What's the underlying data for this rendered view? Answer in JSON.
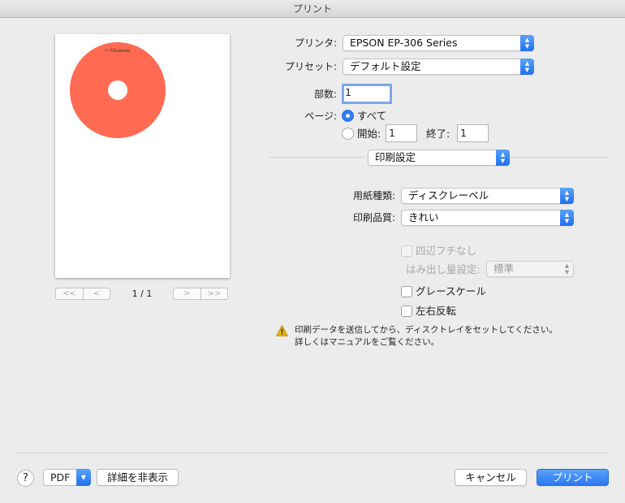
{
  "window": {
    "title": "プリント"
  },
  "preview": {
    "disc_label": "ⓔ-TOLabeler",
    "page_indicator": "1 / 1",
    "nav": {
      "first": "<<",
      "prev": "<",
      "next": ">",
      "last": ">>"
    },
    "disc_color": "#ff6b52"
  },
  "form": {
    "printer": {
      "label": "プリンタ:",
      "value": "EPSON EP-306 Series"
    },
    "preset": {
      "label": "プリセット:",
      "value": "デフォルト設定"
    },
    "copies": {
      "label": "部数:",
      "value": "1"
    },
    "pages": {
      "label": "ページ:",
      "all_label": "すべて",
      "from_label": "開始:",
      "from_value": "1",
      "to_label": "終了:",
      "to_value": "1"
    },
    "section": {
      "value": "印刷設定"
    },
    "media_type": {
      "label": "用紙種類:",
      "value": "ディスクレーベル"
    },
    "print_quality": {
      "label": "印刷品質:",
      "value": "きれい"
    },
    "borderless": {
      "label": "四辺フチなし",
      "checked": false,
      "enabled": false
    },
    "expansion": {
      "label": "はみ出し量設定:",
      "value": "標準",
      "enabled": false
    },
    "grayscale": {
      "label": "グレースケール",
      "checked": false
    },
    "mirror": {
      "label": "左右反転",
      "checked": false
    }
  },
  "warning": {
    "line1": "印刷データを送信してから、ディスクトレイをセットしてください。",
    "line2": "詳しくはマニュアルをご覧ください。"
  },
  "footer": {
    "help": "?",
    "pdf": "PDF",
    "hide_details": "詳細を非表示",
    "cancel": "キャンセル",
    "print": "プリント"
  },
  "colors": {
    "accent": "#2b78f0",
    "warning": "#e8b400"
  }
}
